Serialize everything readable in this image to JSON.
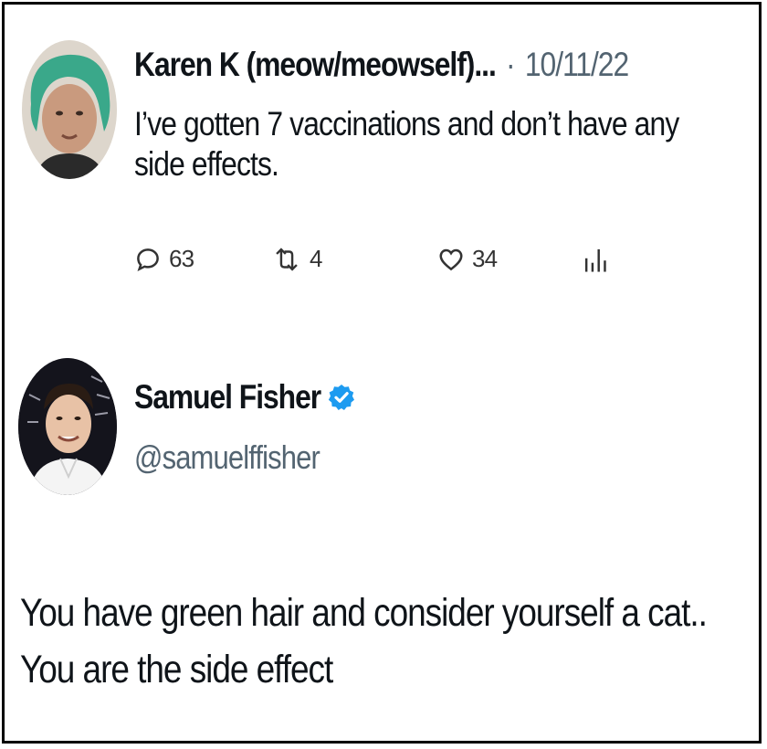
{
  "tweet": {
    "author": "Karen K (meow/meowself)...",
    "separator": "·",
    "date": "10/11/22",
    "text": "I’ve gotten 7 vaccinations and don’t have any side effects.",
    "avatar_icon": "green-hair-person-avatar",
    "actions": {
      "replies": "63",
      "retweets": "4",
      "likes": "34",
      "reply_icon": "reply-icon",
      "retweet_icon": "retweet-icon",
      "like_icon": "heart-icon",
      "views_icon": "views-chart-icon"
    }
  },
  "reply": {
    "author": "Samuel Fisher",
    "verified_icon": "verified-badge-icon",
    "handle": "@samuelffisher",
    "text": "You have green hair and consider yourself a cat.. You are the side effect",
    "avatar_icon": "man-portrait-avatar"
  },
  "colors": {
    "verified": "#1d9bf0",
    "text": "#0f1419",
    "muted": "#536471",
    "frame": "#000000",
    "hair": "#3aa88a"
  }
}
